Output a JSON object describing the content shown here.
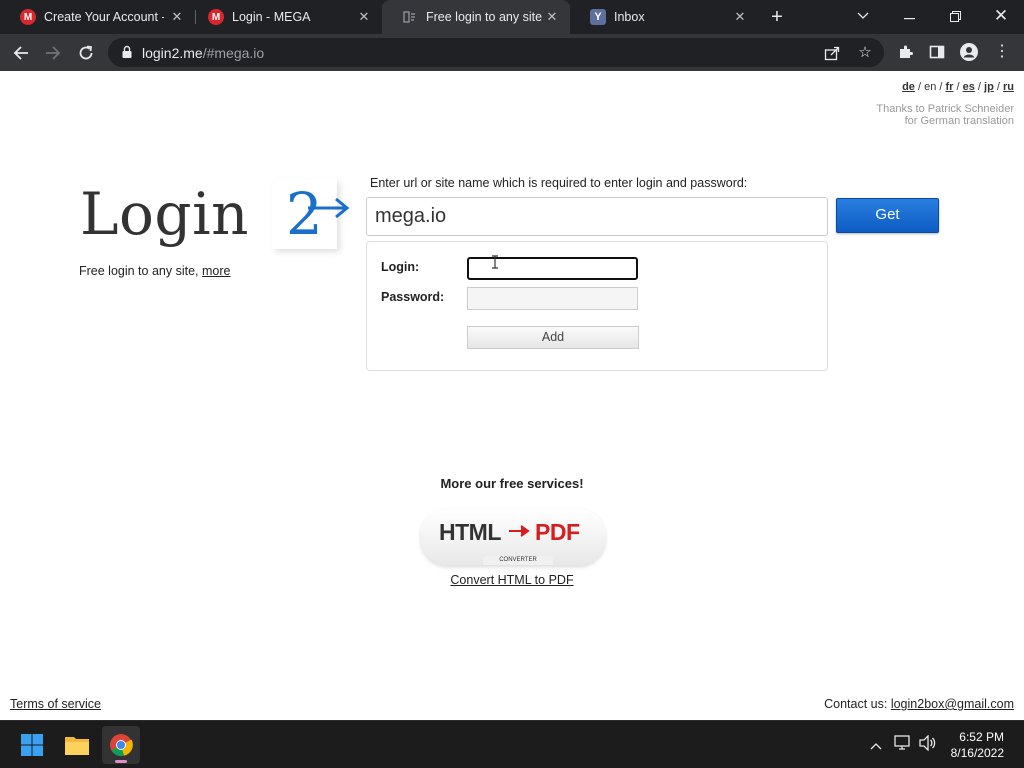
{
  "browser": {
    "tabs": [
      {
        "title": "Create Your Account - MEGA",
        "favicon": "mega-icon"
      },
      {
        "title": "Login - MEGA",
        "favicon": "mega-icon"
      },
      {
        "title": "Free login to any site",
        "favicon": "login2-icon"
      },
      {
        "title": "Inbox",
        "favicon": "yahoo-icon"
      }
    ],
    "active_tab_index": 2,
    "url_host": "login2.me",
    "url_path": "/#mega.io"
  },
  "page": {
    "languages": {
      "items": [
        "de",
        "en",
        "fr",
        "es",
        "jp",
        "ru"
      ],
      "current": "en",
      "separator": " / "
    },
    "thanks_line1": "Thanks to Patrick Schneider",
    "thanks_line2": "for German translation",
    "logo_text": "Login",
    "logo_number": "2",
    "tagline": "Free login to any site, ",
    "tagline_link": "more",
    "prompt": "Enter url or site name which is required to enter login and password:",
    "site_value": "mega.io",
    "get_label": "Get",
    "login_label": "Login:",
    "password_label": "Password:",
    "login_value": "",
    "password_value": "",
    "add_label": "Add",
    "more_services": "More our free services!",
    "badge_html": "HTML",
    "badge_pdf": "PDF",
    "badge_converter": "CONVERTER",
    "convert_link": "Convert HTML to PDF",
    "terms_link": "Terms of service",
    "contact_label": "Contact us: ",
    "contact_email": "login2box@gmail.com"
  },
  "taskbar": {
    "time": "6:52 PM",
    "date": "8/16/2022"
  },
  "colors": {
    "accent_blue": "#1a6fc9",
    "get_button": "#1565d8",
    "pdf_red": "#d61e1e"
  }
}
